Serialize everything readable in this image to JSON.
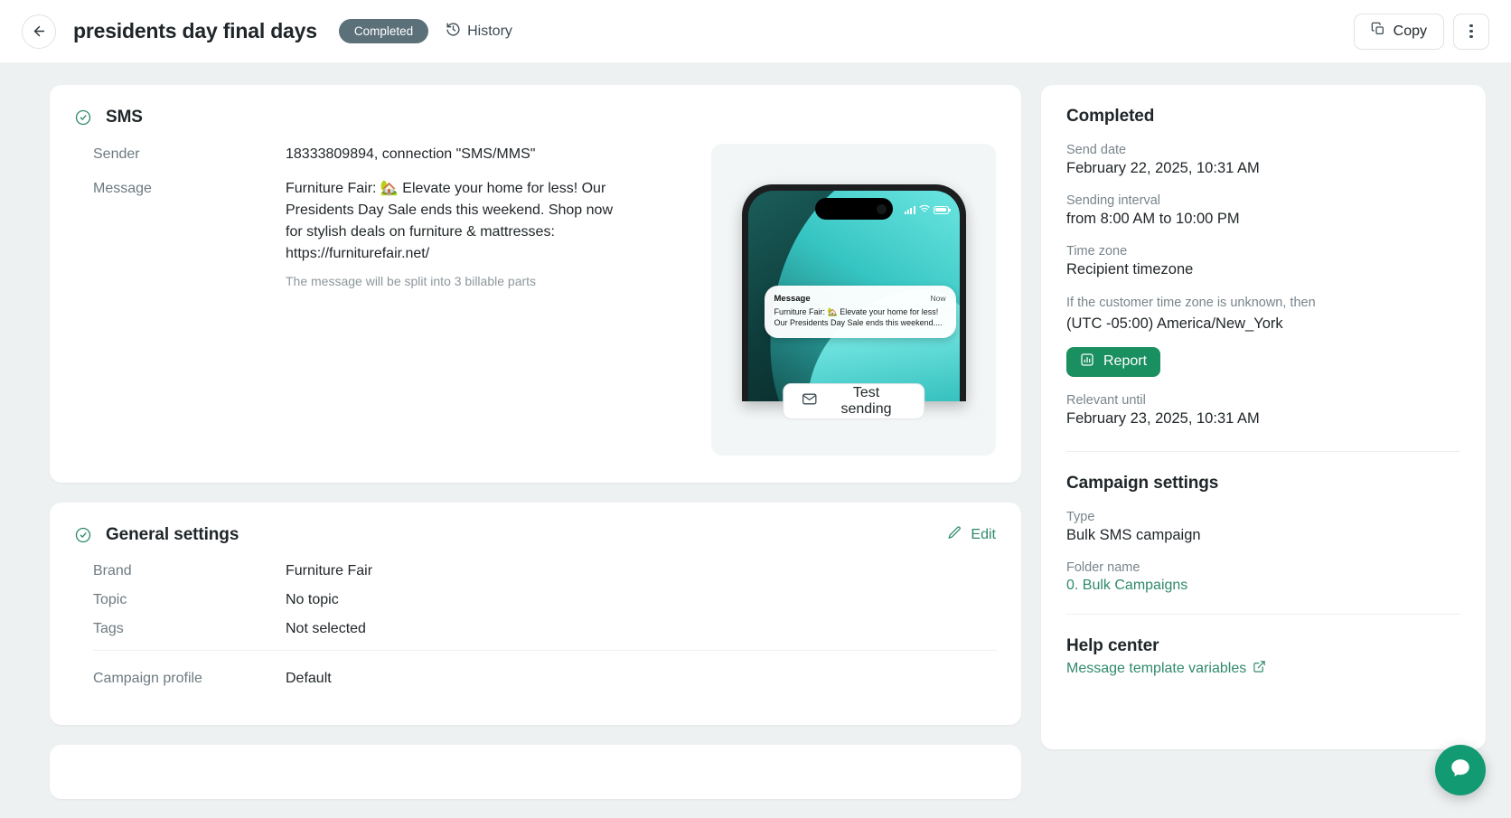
{
  "topbar": {
    "back_icon": "arrow-left-icon",
    "title": "presidents day final days",
    "status": "Completed",
    "history_label": "History",
    "history_icon": "clock-history-icon",
    "copy_label": "Copy",
    "copy_icon": "copy-icon",
    "kebab_icon": "more-vertical-icon"
  },
  "sms_card": {
    "check_icon": "check-circle-icon",
    "title": "SMS",
    "fields": [
      {
        "label": "Sender",
        "value": "18333809894, connection \"SMS/MMS\""
      },
      {
        "label": "Message",
        "value": "Furniture Fair: 🏡 Elevate your home for less! Our Presidents Day Sale ends this weekend. Shop now for stylish deals on furniture & mattresses: https://furniturefair.net/"
      }
    ],
    "note": "The message will be split into 3 billable parts",
    "preview": {
      "notification_title": "Message",
      "notification_time": "Now",
      "notification_text": "Furniture Fair: 🏡 Elevate your home for less! Our Presidents Day Sale ends this weekend....",
      "test_button": "Test sending",
      "test_icon": "envelope-icon"
    }
  },
  "general_settings": {
    "check_icon": "check-circle-icon",
    "title": "General settings",
    "edit_label": "Edit",
    "edit_icon": "pencil-icon",
    "rows": [
      {
        "label": "Brand",
        "value": "Furniture Fair"
      },
      {
        "label": "Topic",
        "value": "No topic"
      },
      {
        "label": "Tags",
        "value": "Not selected"
      }
    ],
    "profile_row": {
      "label": "Campaign profile",
      "value": "Default"
    }
  },
  "sidebar": {
    "status_title": "Completed",
    "send_date_label": "Send date",
    "send_date_value": "February 22, 2025, 10:31 AM",
    "interval_label": "Sending interval",
    "interval_value": "from 8:00 AM to 10:00 PM",
    "timezone_label": "Time zone",
    "timezone_value": "Recipient timezone",
    "timezone_note": "If the customer time zone is unknown, then",
    "timezone_fallback": "(UTC -05:00) America/New_York",
    "report_label": "Report",
    "report_icon": "bar-chart-icon",
    "relevant_label": "Relevant until",
    "relevant_value": "February 23, 2025, 10:31 AM",
    "campaign_settings_title": "Campaign settings",
    "type_label": "Type",
    "type_value": "Bulk SMS campaign",
    "folder_label": "Folder name",
    "folder_value": "0. Bulk Campaigns",
    "help_center_title": "Help center",
    "help_link_label": "Message template variables",
    "help_link_icon": "external-link-icon"
  },
  "chat": {
    "icon": "chat-bubble-icon"
  },
  "colors": {
    "accent_green": "#2f8a6b",
    "report_green": "#1a8f5f",
    "status_pill": "#5b7079",
    "chat_green": "#129a72",
    "page_bg": "#eef1f2"
  }
}
